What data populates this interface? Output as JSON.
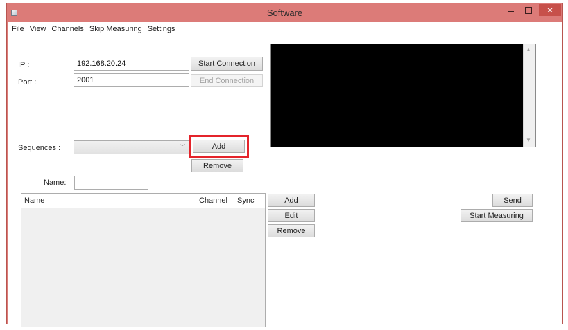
{
  "window": {
    "title": "Software"
  },
  "menu": [
    "File",
    "View",
    "Channels",
    "Skip Measuring",
    "Settings"
  ],
  "connection": {
    "ip_label": "IP :",
    "ip_value": "192.168.20.24",
    "port_label": "Port :",
    "port_value": "2001",
    "start_label": "Start Connection",
    "end_label": "End Connection"
  },
  "sequences": {
    "label": "Sequences :",
    "selected": "",
    "add_label": "Add",
    "remove_label": "Remove"
  },
  "name_field": {
    "label": "Name:",
    "value": ""
  },
  "list": {
    "columns": [
      "Name",
      "Channel",
      "Sync"
    ],
    "rows": []
  },
  "list_actions": {
    "add": "Add",
    "edit": "Edit",
    "remove": "Remove"
  },
  "actions": {
    "send": "Send",
    "start_measuring": "Start Measuring"
  },
  "colors": {
    "titlebar": "#dc7b78",
    "close": "#c7504a",
    "highlight": "#e4242b",
    "console": "#000000"
  },
  "icons": [
    "app-icon",
    "minimize-icon",
    "maximize-icon",
    "close-icon",
    "chevron-down-icon",
    "scroll-up-icon",
    "scroll-down-icon"
  ]
}
